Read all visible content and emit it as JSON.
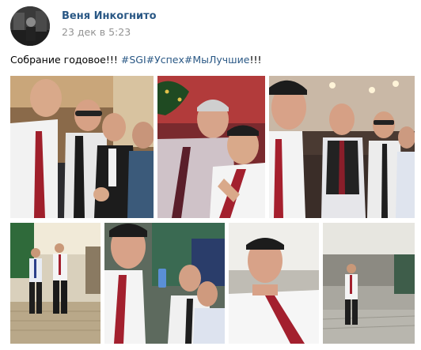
{
  "post": {
    "author_name": "Веня Инкогнито",
    "date": "23 дек в 5:23",
    "text_plain": "Собрание годовое!!! ",
    "hashtags": [
      "#SGI",
      "#Успех",
      "#МыЛучшие"
    ],
    "text_tail": "!!!"
  },
  "photos": [
    {
      "name": "photo-group-selfie"
    },
    {
      "name": "photo-two-men-selfie"
    },
    {
      "name": "photo-hall-group"
    },
    {
      "name": "photo-two-men-stairs"
    },
    {
      "name": "photo-selfie-drink"
    },
    {
      "name": "photo-close-selfie"
    },
    {
      "name": "photo-man-lobby"
    }
  ],
  "colors": {
    "link": "#2a5885",
    "meta": "#939393",
    "text": "#000000"
  }
}
